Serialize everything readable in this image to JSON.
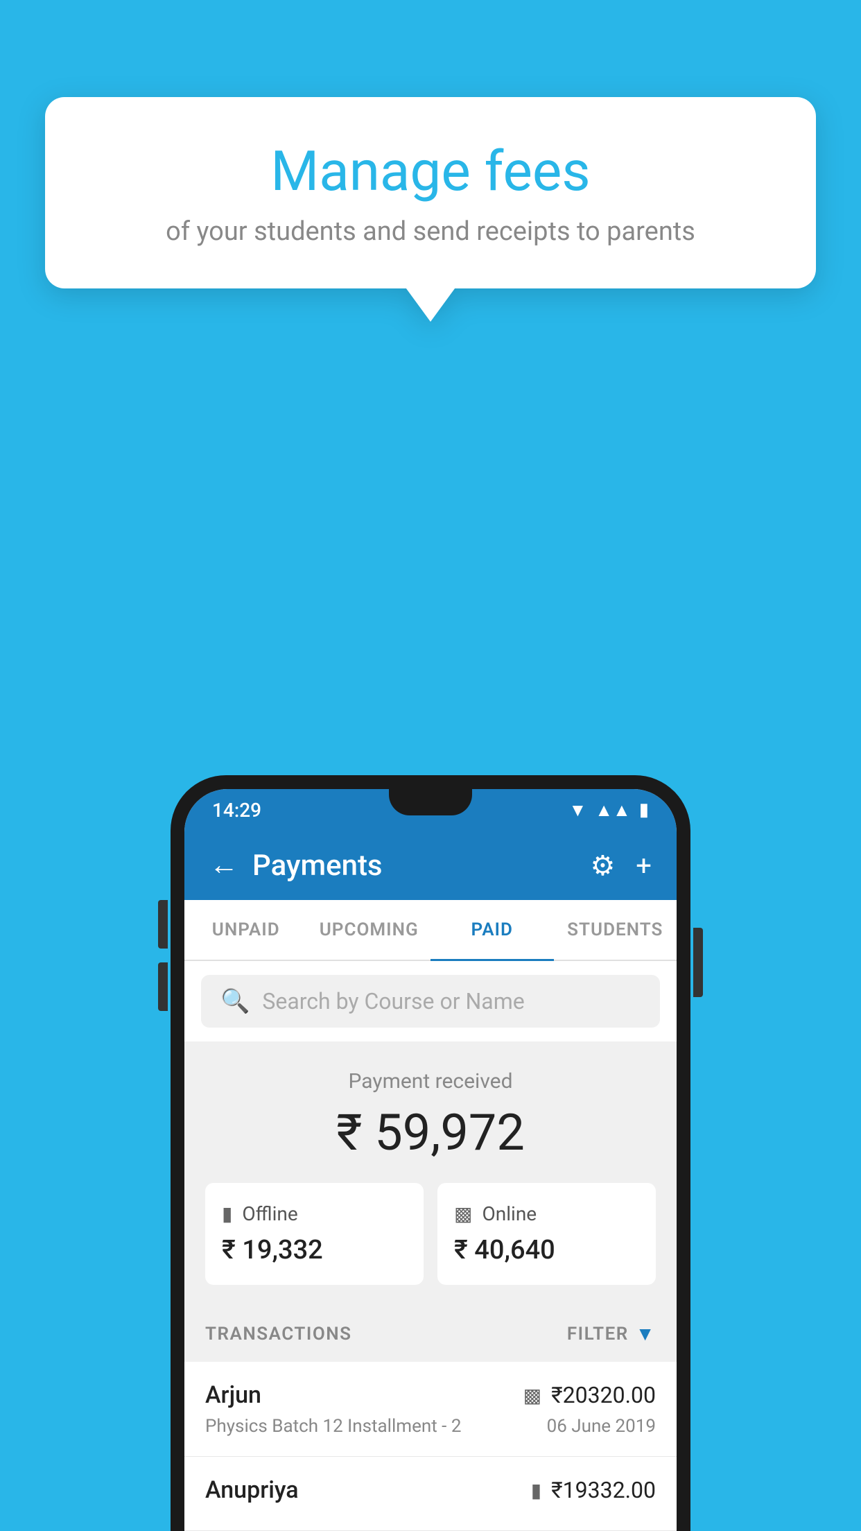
{
  "page": {
    "background_color": "#29b6e8"
  },
  "bubble": {
    "title": "Manage fees",
    "subtitle": "of your students and send receipts to parents"
  },
  "status_bar": {
    "time": "14:29",
    "icons": [
      "wifi",
      "signal",
      "battery"
    ]
  },
  "app_bar": {
    "title": "Payments",
    "back_label": "←",
    "gear_label": "⚙",
    "plus_label": "+"
  },
  "tabs": [
    {
      "label": "UNPAID",
      "active": false
    },
    {
      "label": "UPCOMING",
      "active": false
    },
    {
      "label": "PAID",
      "active": true
    },
    {
      "label": "STUDENTS",
      "active": false
    }
  ],
  "search": {
    "placeholder": "Search by Course or Name"
  },
  "payment_summary": {
    "label": "Payment received",
    "total": "₹ 59,972",
    "offline_label": "Offline",
    "offline_amount": "₹ 19,332",
    "online_label": "Online",
    "online_amount": "₹ 40,640"
  },
  "transactions": {
    "header_label": "TRANSACTIONS",
    "filter_label": "FILTER",
    "items": [
      {
        "name": "Arjun",
        "course": "Physics Batch 12 Installment - 2",
        "date": "06 June 2019",
        "amount": "₹20320.00",
        "payment_type": "online"
      },
      {
        "name": "Anupriya",
        "course": "",
        "date": "",
        "amount": "₹19332.00",
        "payment_type": "offline"
      }
    ]
  }
}
